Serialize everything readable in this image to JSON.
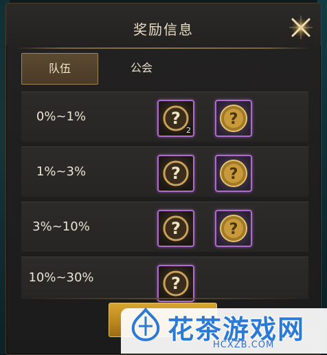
{
  "title": "奖励信息",
  "tabs": [
    {
      "label": "队伍",
      "active": true
    },
    {
      "label": "公会",
      "active": false
    }
  ],
  "rows": [
    {
      "rank": "0%~1%",
      "items": [
        {
          "icon": "mystery-box-icon",
          "qty": "2"
        },
        {
          "icon": "mystery-medal-icon",
          "qty": ""
        }
      ]
    },
    {
      "rank": "1%~3%",
      "items": [
        {
          "icon": "mystery-box-icon",
          "qty": ""
        },
        {
          "icon": "mystery-medal-icon",
          "qty": ""
        }
      ]
    },
    {
      "rank": "3%~10%",
      "items": [
        {
          "icon": "mystery-box-icon",
          "qty": ""
        },
        {
          "icon": "mystery-medal-icon",
          "qty": ""
        }
      ]
    },
    {
      "rank": "10%~30%",
      "items": [
        {
          "icon": "mystery-box-icon",
          "qty": ""
        }
      ]
    }
  ],
  "watermark": {
    "text": "花茶游戏网",
    "url": "HCXZB.COM"
  },
  "colors": {
    "accent_gold": "#d8a530",
    "item_border": "#b06bd0",
    "watermark": "#2a7ad6"
  }
}
